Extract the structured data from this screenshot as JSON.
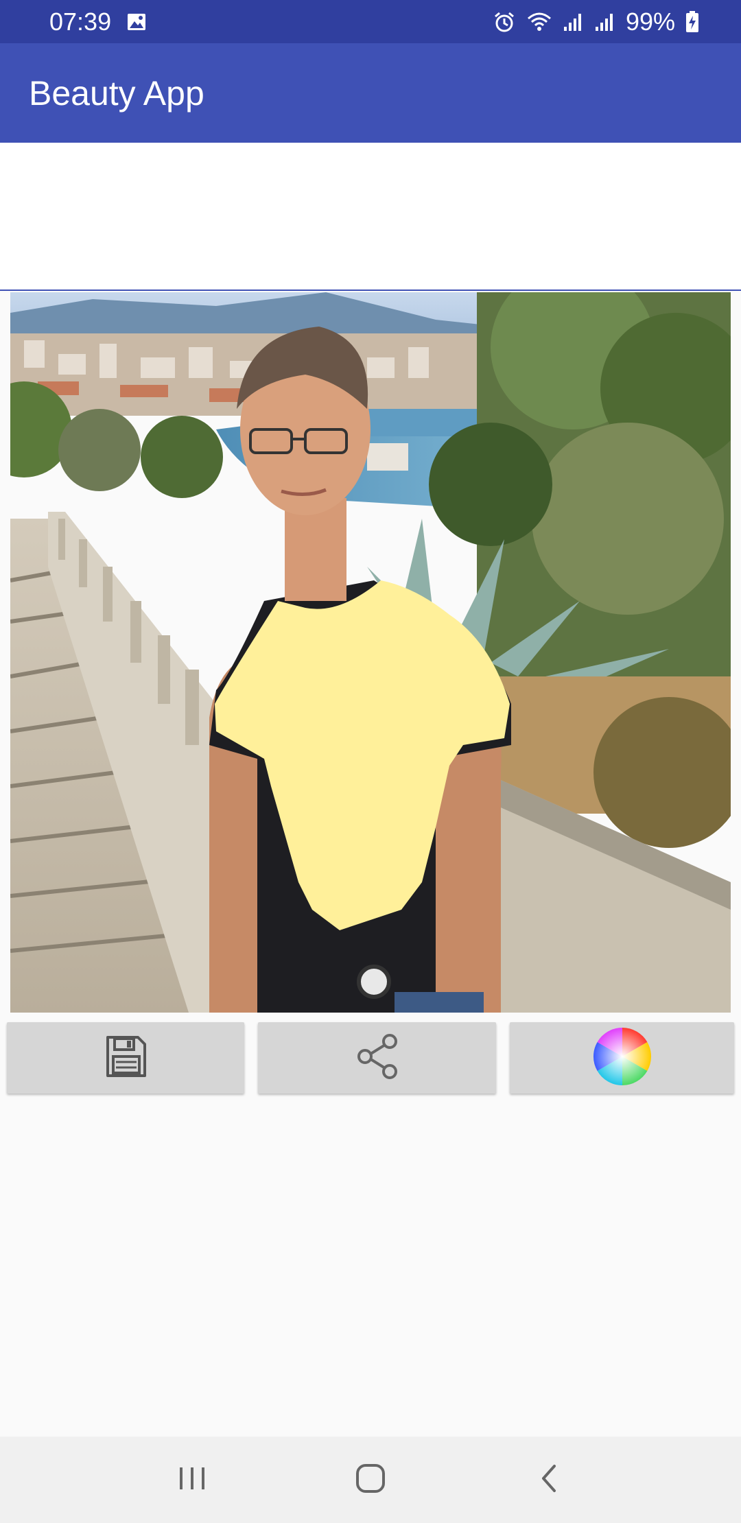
{
  "status_bar": {
    "time": "07:39",
    "battery_percent": "99%",
    "icons": [
      "image-icon",
      "alarm-icon",
      "wifi-icon",
      "signal-icon",
      "signal-icon",
      "battery-charging-icon"
    ]
  },
  "app_bar": {
    "title": "Beauty App"
  },
  "photo": {
    "icon": "edited-photo",
    "shirt_color": "#fff09a"
  },
  "actions": {
    "save_icon": "save-icon",
    "share_icon": "share-icon",
    "color_icon": "color-wheel-icon"
  },
  "nav_bar": {
    "icons": [
      "recent-apps-icon",
      "home-icon",
      "back-icon"
    ]
  },
  "colors": {
    "status_bar": "#303f9f",
    "app_bar": "#3f51b5",
    "button_bg": "#d6d6d6",
    "page_bg": "#fafafa"
  }
}
